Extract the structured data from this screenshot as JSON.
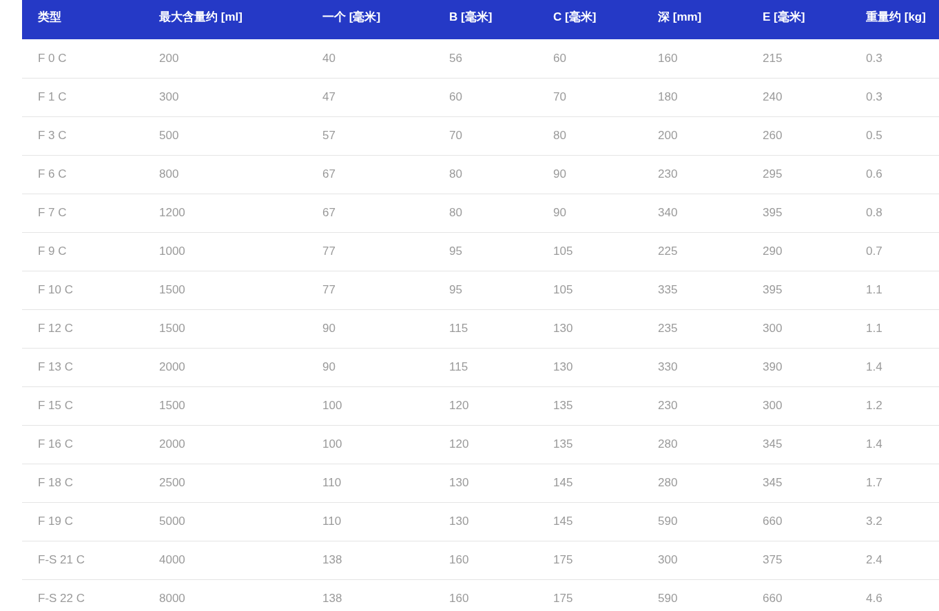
{
  "table": {
    "columns": [
      "类型",
      "最大含量约 [ml]",
      "一个 [毫米]",
      "B [毫米]",
      "C [毫米]",
      "深 [mm]",
      "E [毫米]",
      "重量约 [kg]"
    ],
    "rows": [
      [
        "F 0 C",
        "200",
        "40",
        "56",
        "60",
        "160",
        "215",
        "0.3"
      ],
      [
        "F 1 C",
        "300",
        "47",
        "60",
        "70",
        "180",
        "240",
        "0.3"
      ],
      [
        "F 3 C",
        "500",
        "57",
        "70",
        "80",
        "200",
        "260",
        "0.5"
      ],
      [
        "F 6 C",
        "800",
        "67",
        "80",
        "90",
        "230",
        "295",
        "0.6"
      ],
      [
        "F 7 C",
        "1200",
        "67",
        "80",
        "90",
        "340",
        "395",
        "0.8"
      ],
      [
        "F 9 C",
        "1000",
        "77",
        "95",
        "105",
        "225",
        "290",
        "0.7"
      ],
      [
        "F 10 C",
        "1500",
        "77",
        "95",
        "105",
        "335",
        "395",
        "1.1"
      ],
      [
        "F 12 C",
        "1500",
        "90",
        "115",
        "130",
        "235",
        "300",
        "1.1"
      ],
      [
        "F 13 C",
        "2000",
        "90",
        "115",
        "130",
        "330",
        "390",
        "1.4"
      ],
      [
        "F 15 C",
        "1500",
        "100",
        "120",
        "135",
        "230",
        "300",
        "1.2"
      ],
      [
        "F 16 C",
        "2000",
        "100",
        "120",
        "135",
        "280",
        "345",
        "1.4"
      ],
      [
        "F 18 C",
        "2500",
        "110",
        "130",
        "145",
        "280",
        "345",
        "1.7"
      ],
      [
        "F 19 C",
        "5000",
        "110",
        "130",
        "145",
        "590",
        "660",
        "3.2"
      ],
      [
        "F-S 21 C",
        "4000",
        "138",
        "160",
        "175",
        "300",
        "375",
        "2.4"
      ],
      [
        "F-S 22 C",
        "8000",
        "138",
        "160",
        "175",
        "590",
        "660",
        "4.6"
      ]
    ]
  }
}
